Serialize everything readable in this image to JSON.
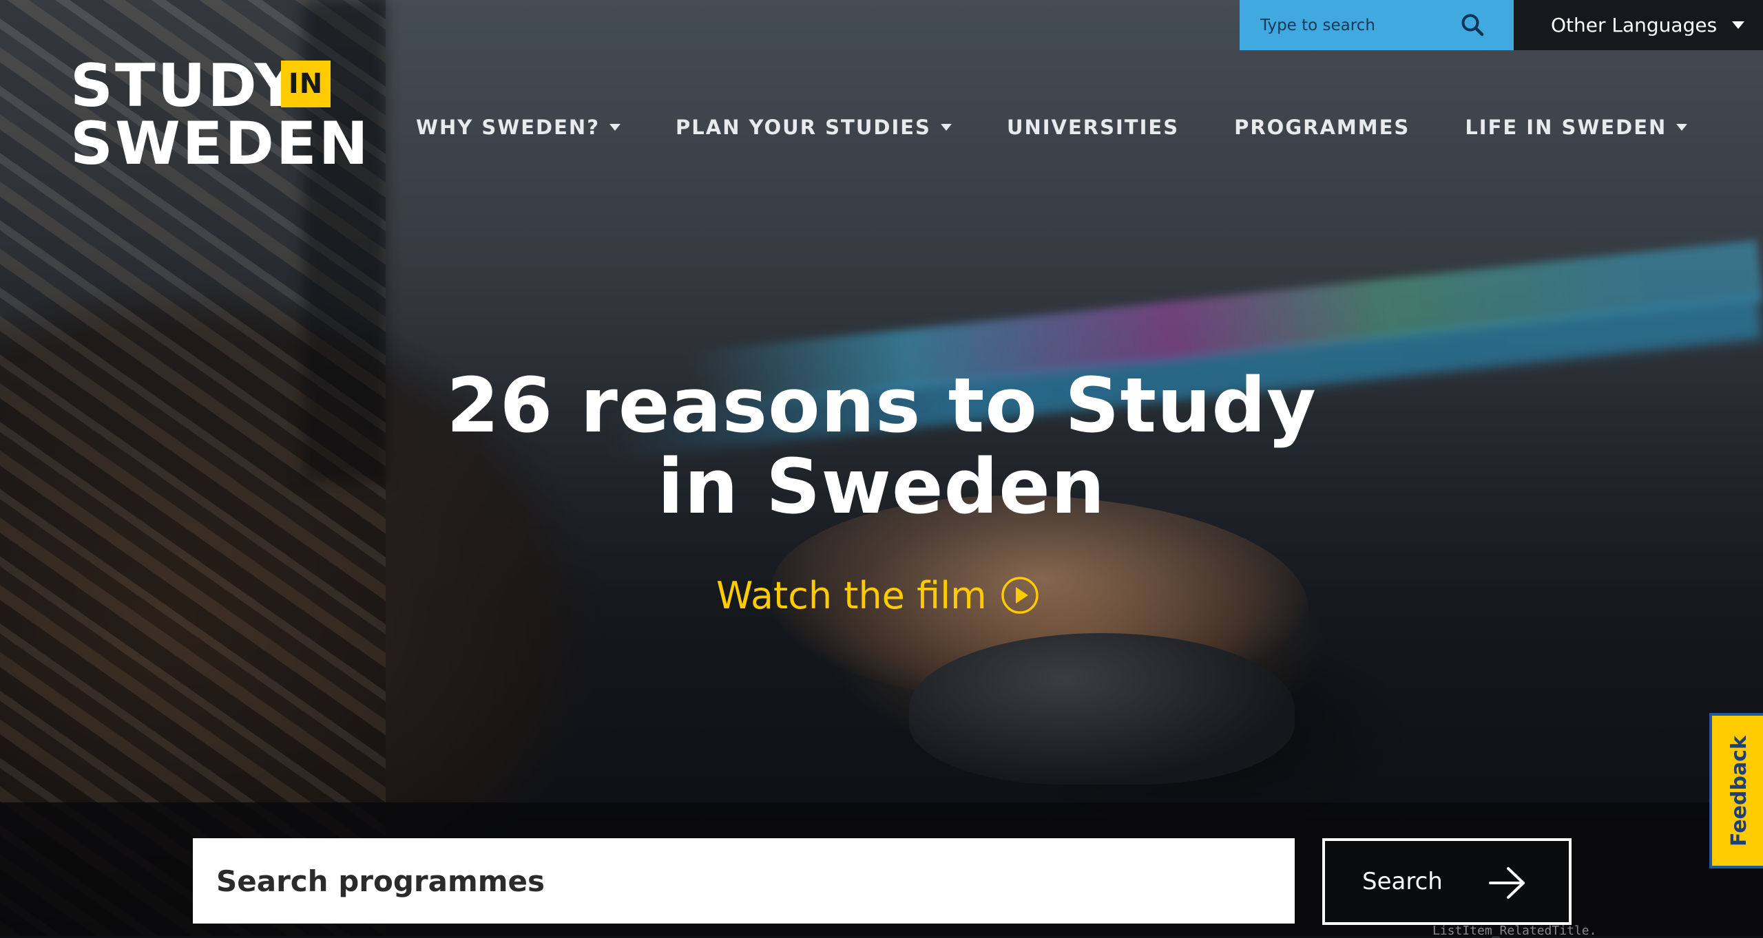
{
  "header": {
    "search_placeholder": "Type to search",
    "language_label": "Other Languages"
  },
  "logo": {
    "line1": "STUDY",
    "badge": "IN",
    "line2": "SWEDEN"
  },
  "nav": {
    "items": [
      {
        "label": "WHY SWEDEN?",
        "has_dropdown": true
      },
      {
        "label": "PLAN YOUR STUDIES",
        "has_dropdown": true
      },
      {
        "label": "UNIVERSITIES",
        "has_dropdown": false
      },
      {
        "label": "PROGRAMMES",
        "has_dropdown": false
      },
      {
        "label": "LIFE IN SWEDEN",
        "has_dropdown": true
      }
    ]
  },
  "hero": {
    "headline_line1": "26 reasons to Study",
    "headline_line2": "in Sweden",
    "cta_label": "Watch the film"
  },
  "programme_search": {
    "placeholder": "Search programmes",
    "button_label": "Search"
  },
  "feedback": {
    "label": "Feedback"
  },
  "stray_text": "ListItem_RelatedTitle.",
  "colors": {
    "accent_yellow": "#fecb00",
    "search_blue": "#3fa9e0",
    "dark": "#16191c",
    "feedback_border": "#1f5aa0"
  },
  "icons": {
    "search": "search-icon",
    "language_caret": "chevron-down-icon",
    "play": "play-circle-icon",
    "arrow": "arrow-right-icon"
  }
}
